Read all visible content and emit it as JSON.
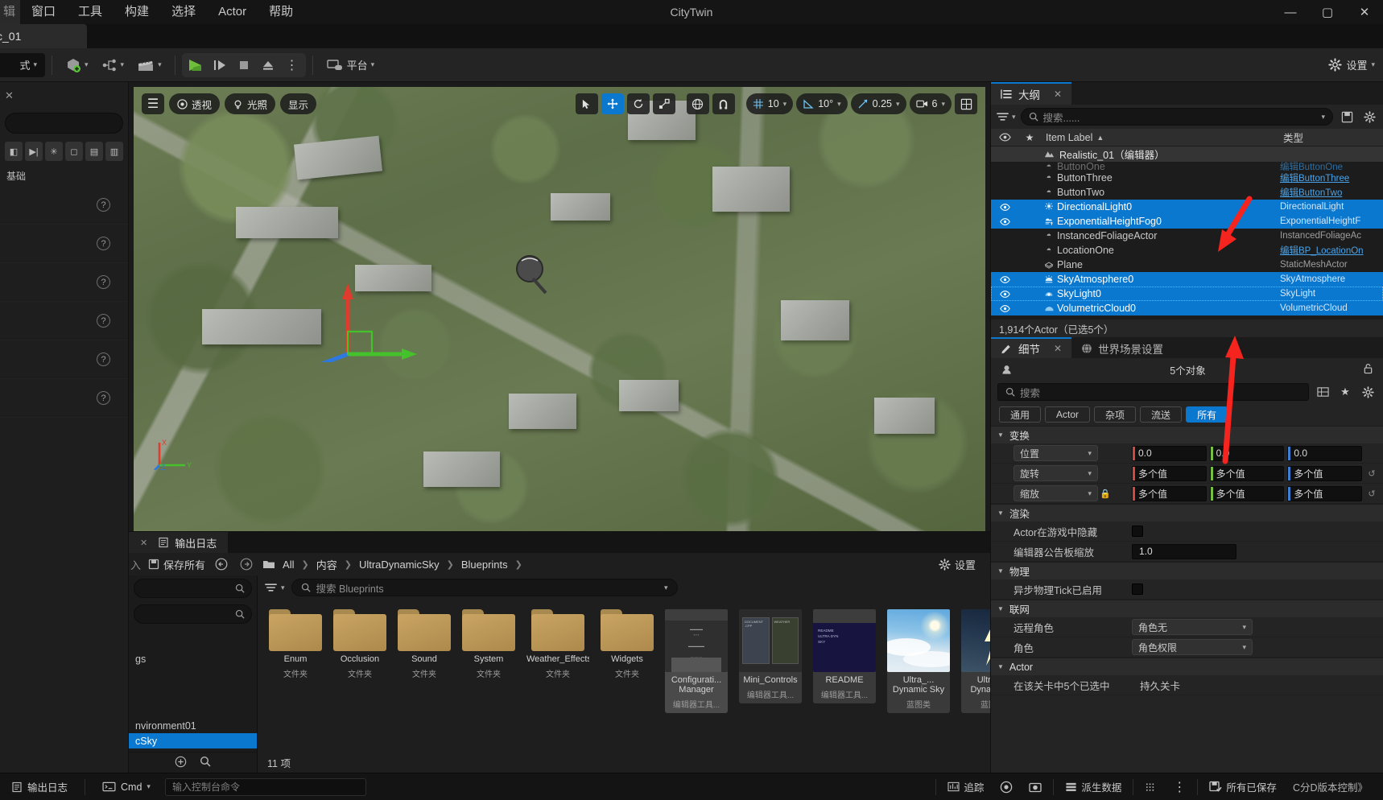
{
  "window": {
    "title": "CityTwin",
    "minimize": "—",
    "maximize": "▢",
    "close": "✕"
  },
  "menu": {
    "items": [
      "窗口",
      "工具",
      "构建",
      "选择",
      "Actor",
      "帮助"
    ],
    "clipped_first": "辑"
  },
  "level_tab": {
    "label": "c_01"
  },
  "toolbar": {
    "mode_label": "式",
    "add_label": "",
    "blueprint_label": "",
    "cinematic_label": "",
    "play": "▶",
    "skip": "▐▶",
    "stop": "■",
    "eject": "⏏",
    "more": "⋮",
    "platform_label": "平台",
    "settings_label": "设置"
  },
  "left_panel": {
    "close": "✕",
    "section_label": "基础",
    "help_rows": [
      "?",
      "?",
      "?",
      "?",
      "?",
      "?"
    ]
  },
  "viewport": {
    "menu_icon": "☰",
    "perspective": "透视",
    "lighting": "光照",
    "show": "显示",
    "grid_snap": "10",
    "angle_snap": "10°",
    "scale_snap": "0.25",
    "camera_speed": "6",
    "gizmo_x": "X",
    "gizmo_y": "Y",
    "gizmo_z": "Z"
  },
  "outliner": {
    "tab_label": "大纲",
    "tab_close": "✕",
    "search_placeholder": "搜索......",
    "columns": {
      "eye": "👁",
      "star": "★",
      "label": "Item Label",
      "sort": "▲",
      "type": "类型"
    },
    "root": "Realistic_01（编辑器）",
    "rows": [
      {
        "label": "ButtonOne",
        "type": "编辑ButtonOne",
        "type_link": true,
        "icon": "actor",
        "selected": false,
        "visible": false,
        "clipped": true
      },
      {
        "label": "ButtonThree",
        "type": "编辑ButtonThree",
        "type_link": true,
        "icon": "actor",
        "selected": false,
        "visible": false
      },
      {
        "label": "ButtonTwo",
        "type": "编辑ButtonTwo",
        "type_link": true,
        "icon": "actor",
        "selected": false,
        "visible": false
      },
      {
        "label": "DirectionalLight0",
        "type": "DirectionalLight",
        "type_link": false,
        "icon": "light",
        "selected": true,
        "visible": true
      },
      {
        "label": "ExponentialHeightFog0",
        "type": "ExponentialHeightF",
        "type_link": false,
        "icon": "fog",
        "selected": true,
        "visible": true
      },
      {
        "label": "InstancedFoliageActor",
        "type": "InstancedFoliageAc",
        "type_link": false,
        "icon": "actor",
        "selected": false,
        "visible": false
      },
      {
        "label": "LocationOne",
        "type": "编辑BP_LocationOn",
        "type_link": true,
        "icon": "actor",
        "selected": false,
        "visible": false
      },
      {
        "label": "Plane",
        "type": "StaticMeshActor",
        "type_link": false,
        "icon": "mesh",
        "selected": false,
        "visible": false
      },
      {
        "label": "SkyAtmosphere0",
        "type": "SkyAtmosphere",
        "type_link": false,
        "icon": "atmos",
        "selected": true,
        "visible": true
      },
      {
        "label": "SkyLight0",
        "type": "SkyLight",
        "type_link": false,
        "icon": "skylight",
        "selected": true,
        "visible": true,
        "focused": true
      },
      {
        "label": "VolumetricCloud0",
        "type": "VolumetricCloud",
        "type_link": false,
        "icon": "cloud",
        "selected": true,
        "visible": true
      }
    ],
    "footer": "1,914个Actor（已选5个）"
  },
  "details": {
    "tab_label": "细节",
    "tab_close": "✕",
    "world_tab_label": "世界场景设置",
    "object_count": "5个对象",
    "search_placeholder": "搜索",
    "filters": [
      {
        "label": "通用",
        "active": false
      },
      {
        "label": "Actor",
        "active": false
      },
      {
        "label": "杂项",
        "active": false
      },
      {
        "label": "流送",
        "active": false
      },
      {
        "label": "所有",
        "active": true
      }
    ],
    "sections": [
      {
        "title": "变换",
        "rows": [
          {
            "kind": "vector",
            "label": "位置",
            "values": [
              "0.0",
              "0.0",
              "0.0"
            ],
            "locked": false
          },
          {
            "kind": "vector",
            "label": "旋转",
            "values": [
              "多个值",
              "多个值",
              "多个值"
            ],
            "locked": false,
            "reset": "↺"
          },
          {
            "kind": "vector",
            "label": "缩放",
            "values": [
              "多个值",
              "多个值",
              "多个值"
            ],
            "locked": true,
            "reset": "↺"
          }
        ]
      },
      {
        "title": "渲染",
        "rows": [
          {
            "kind": "checkbox",
            "label": "Actor在游戏中隐藏",
            "checked": false
          },
          {
            "kind": "text",
            "label": "编辑器公告板缩放",
            "value": "1.0"
          }
        ]
      },
      {
        "title": "物理",
        "rows": [
          {
            "kind": "checkbox",
            "label": "异步物理Tick已启用",
            "checked": false
          }
        ]
      },
      {
        "title": "联网",
        "rows": [
          {
            "kind": "combo",
            "label": "远程角色",
            "value": "角色无"
          },
          {
            "kind": "combo",
            "label": "角色",
            "value": "角色权限"
          }
        ]
      },
      {
        "title": "Actor",
        "rows": [
          {
            "kind": "text_plain",
            "label": "在该关卡中5个已选中",
            "value": "持久关卡"
          }
        ]
      }
    ]
  },
  "content_browser": {
    "tab_close": "✕",
    "log_tab_label": "输出日志",
    "save_all": "保存所有",
    "nav_back": "←",
    "nav_forward": "→",
    "breadcrumbs": [
      "All",
      "内容",
      "UltraDynamicSky",
      "Blueprints"
    ],
    "settings_label": "设置",
    "search_placeholder": "搜索 Blueprints",
    "tree": {
      "items": [
        "gs",
        "nvironment01",
        "cSky"
      ],
      "selected_index": 2,
      "add_icon": "+",
      "search_icon": "🔍"
    },
    "assets": [
      {
        "name": "Enum",
        "type": "文件夹",
        "kind": "folder"
      },
      {
        "name": "Occlusion",
        "type": "文件夹",
        "kind": "folder"
      },
      {
        "name": "Sound",
        "type": "文件夹",
        "kind": "folder"
      },
      {
        "name": "System",
        "type": "文件夹",
        "kind": "folder"
      },
      {
        "name": "Weather_Effects",
        "type": "文件夹",
        "kind": "folder"
      },
      {
        "name": "Widgets",
        "type": "文件夹",
        "kind": "folder"
      },
      {
        "name": "Configurati... Manager",
        "type": "编辑器工具...",
        "kind": "doc",
        "selected": true
      },
      {
        "name": "Mini_Controls",
        "type": "编辑器工具...",
        "kind": "panels"
      },
      {
        "name": "README",
        "type": "编辑器工具...",
        "kind": "readme"
      },
      {
        "name": "Ultra_... Dynamic Sky",
        "type": "蓝图类",
        "kind": "sky"
      },
      {
        "name": "Ultra_... Dynamic ...",
        "type": "蓝图类",
        "kind": "storm"
      }
    ],
    "item_count": "11 项"
  },
  "status_bar": {
    "log_label": "输出日志",
    "cmd_label": "Cmd",
    "cmd_placeholder": "输入控制台命令",
    "trace_label": "追踪",
    "derived_data_label": "派生数据",
    "more": "⋮",
    "all_saved_label": "所有已保存",
    "revision_label": "C分D版本控制》"
  },
  "colors": {
    "accent": "#0b78d0",
    "selection": "#0b78d0",
    "arrow": "#f5241f",
    "axis_x": "#d3473f",
    "axis_y": "#78c043",
    "axis_z": "#3f7fd3",
    "folder": "#c9a463"
  }
}
